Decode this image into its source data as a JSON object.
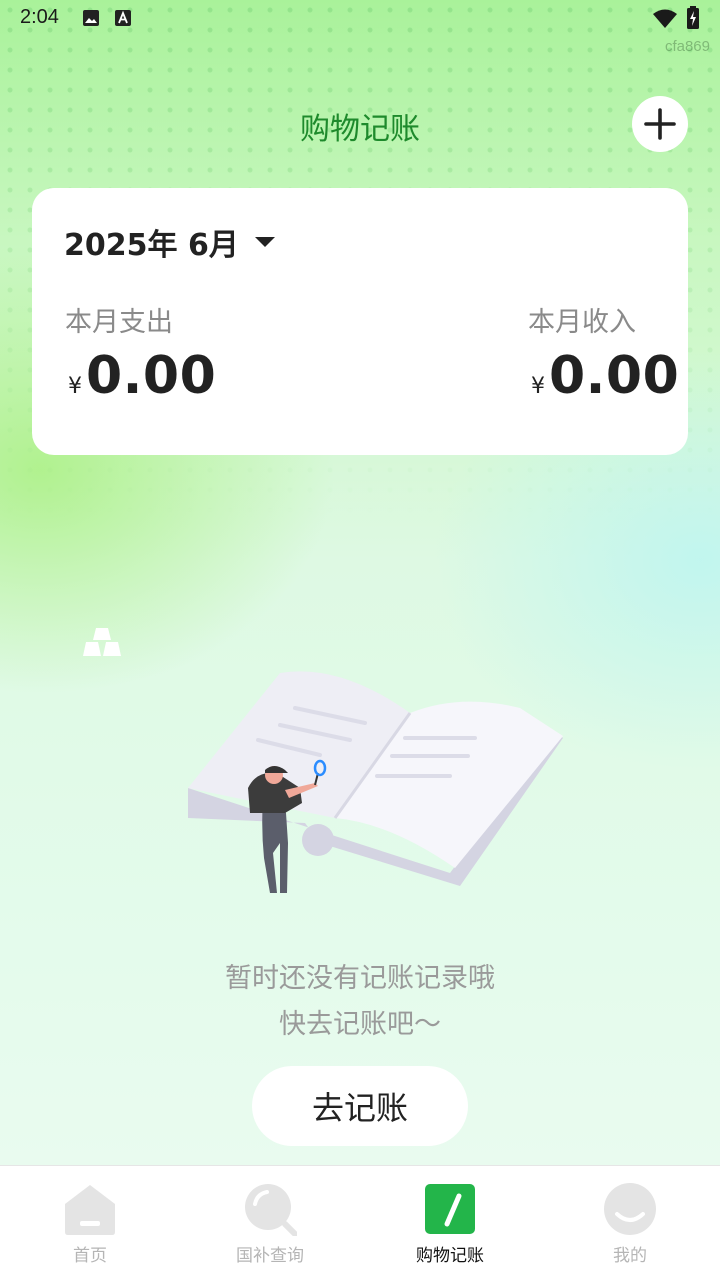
{
  "status_bar": {
    "time": "2:04",
    "icons": [
      "image-icon",
      "font-icon",
      "wifi-icon",
      "battery-charging-icon"
    ],
    "watermark": "cfa869"
  },
  "header": {
    "title": "购物记账",
    "add_icon": "plus-icon"
  },
  "summary": {
    "month": "2025年 6月",
    "expense_label": "本月支出",
    "expense_currency": "¥",
    "expense_value": "0.00",
    "income_label": "本月收入",
    "income_currency": "¥",
    "income_value": "0.00"
  },
  "empty_state": {
    "line1": "暂时还没有记账记录哦",
    "line2": "快去记账吧～",
    "button_label": "去记账"
  },
  "bottom_nav": {
    "items": [
      {
        "label": "首页",
        "icon": "home-icon",
        "active": false
      },
      {
        "label": "国补查询",
        "icon": "search-icon",
        "active": false
      },
      {
        "label": "购物记账",
        "icon": "edit-icon",
        "active": true
      },
      {
        "label": "我的",
        "icon": "profile-icon",
        "active": false
      }
    ]
  },
  "colors": {
    "accent": "#23b54a",
    "title_green": "#1e8a2c"
  }
}
